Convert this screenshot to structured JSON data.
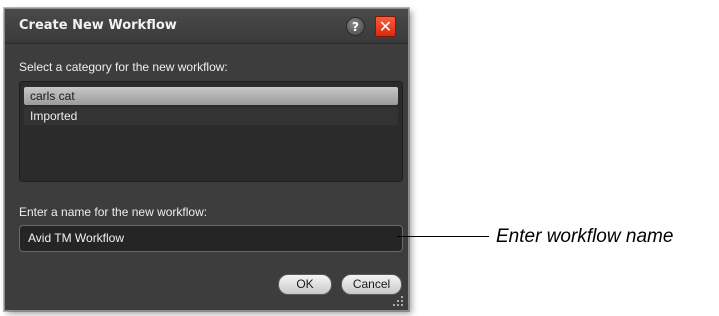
{
  "dialog": {
    "title": "Create New Workflow",
    "help_label": "?",
    "close_label": "✕",
    "category_prompt": "Select a category for the new workflow:",
    "categories": [
      {
        "label": "carls cat",
        "selected": true
      },
      {
        "label": "Imported",
        "selected": false
      }
    ],
    "name_prompt": "Enter a name for the new workflow:",
    "name_value": "Avid TM Workflow",
    "ok_label": "OK",
    "cancel_label": "Cancel"
  },
  "annotation": {
    "callout_text": "Enter workflow name"
  },
  "colors": {
    "dialog_bg": "#3d3d3d",
    "close_button": "#e0361c",
    "selected_item": "#b5b5b5"
  },
  "icons": {
    "help": "help-icon",
    "close": "close-icon",
    "resize": "resize-grip-icon"
  }
}
